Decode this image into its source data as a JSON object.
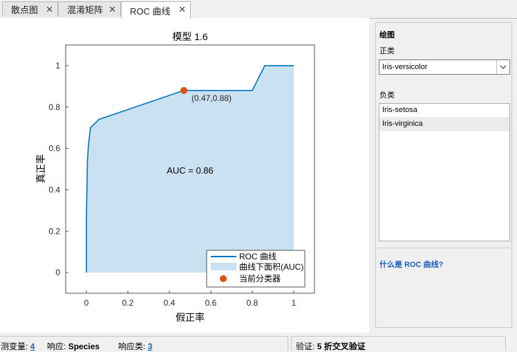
{
  "tabs": [
    {
      "label": "散点图",
      "active": false
    },
    {
      "label": "混淆矩阵",
      "active": false
    },
    {
      "label": "ROC 曲线",
      "active": true
    }
  ],
  "close_glyph": "✕",
  "chart_data": {
    "type": "area",
    "title": "模型 1.6",
    "xlabel": "假正率",
    "ylabel": "真正率",
    "xlim": [
      -0.1,
      1.1
    ],
    "ylim": [
      -0.1,
      1.1
    ],
    "xticks": [
      0,
      0.2,
      0.4,
      0.6,
      0.8,
      1
    ],
    "yticks": [
      0,
      0.2,
      0.4,
      0.6,
      0.8,
      1
    ],
    "xtick_labels": [
      "0",
      "0.2",
      "0.4",
      "0.6",
      "0.8",
      "1"
    ],
    "ytick_labels": [
      "0",
      "0.2",
      "0.4",
      "0.6",
      "0.8",
      "1"
    ],
    "roc_curve": {
      "x": [
        0,
        0,
        0.005,
        0.01,
        0.02,
        0.06,
        0.47,
        0.8,
        0.86,
        1
      ],
      "y": [
        0,
        0.26,
        0.54,
        0.62,
        0.7,
        0.74,
        0.88,
        0.88,
        1.0,
        1.0
      ]
    },
    "current_point": {
      "x": 0.47,
      "y": 0.88,
      "label": "(0.47,0.88)"
    },
    "auc_label": "AUC = 0.86",
    "legend": [
      {
        "label": "ROC 曲线",
        "kind": "line"
      },
      {
        "label": "曲线下面积(AUC)",
        "kind": "area"
      },
      {
        "label": "当前分类器",
        "kind": "marker"
      }
    ],
    "legend_position": "bottom-right",
    "colors": {
      "line": "#0072bd",
      "area": "#c9e1f0",
      "marker": "#d95319"
    }
  },
  "panel": {
    "title": "绘图",
    "positive_label": "正类",
    "positive_value": "Iris-versicolor",
    "negative_label": "负类",
    "negative_items": [
      "Iris-setosa",
      "Iris-virginica"
    ],
    "help_link": "什么是 ROC 曲线?"
  },
  "status": {
    "predictors_label": "测变量:",
    "predictors_value": "4",
    "response_label": "响应:",
    "response_value": "Species",
    "response_classes_label": "响应类:",
    "response_classes_value": "3",
    "validation_label": "验证:",
    "validation_value": "5 折交叉验证"
  }
}
